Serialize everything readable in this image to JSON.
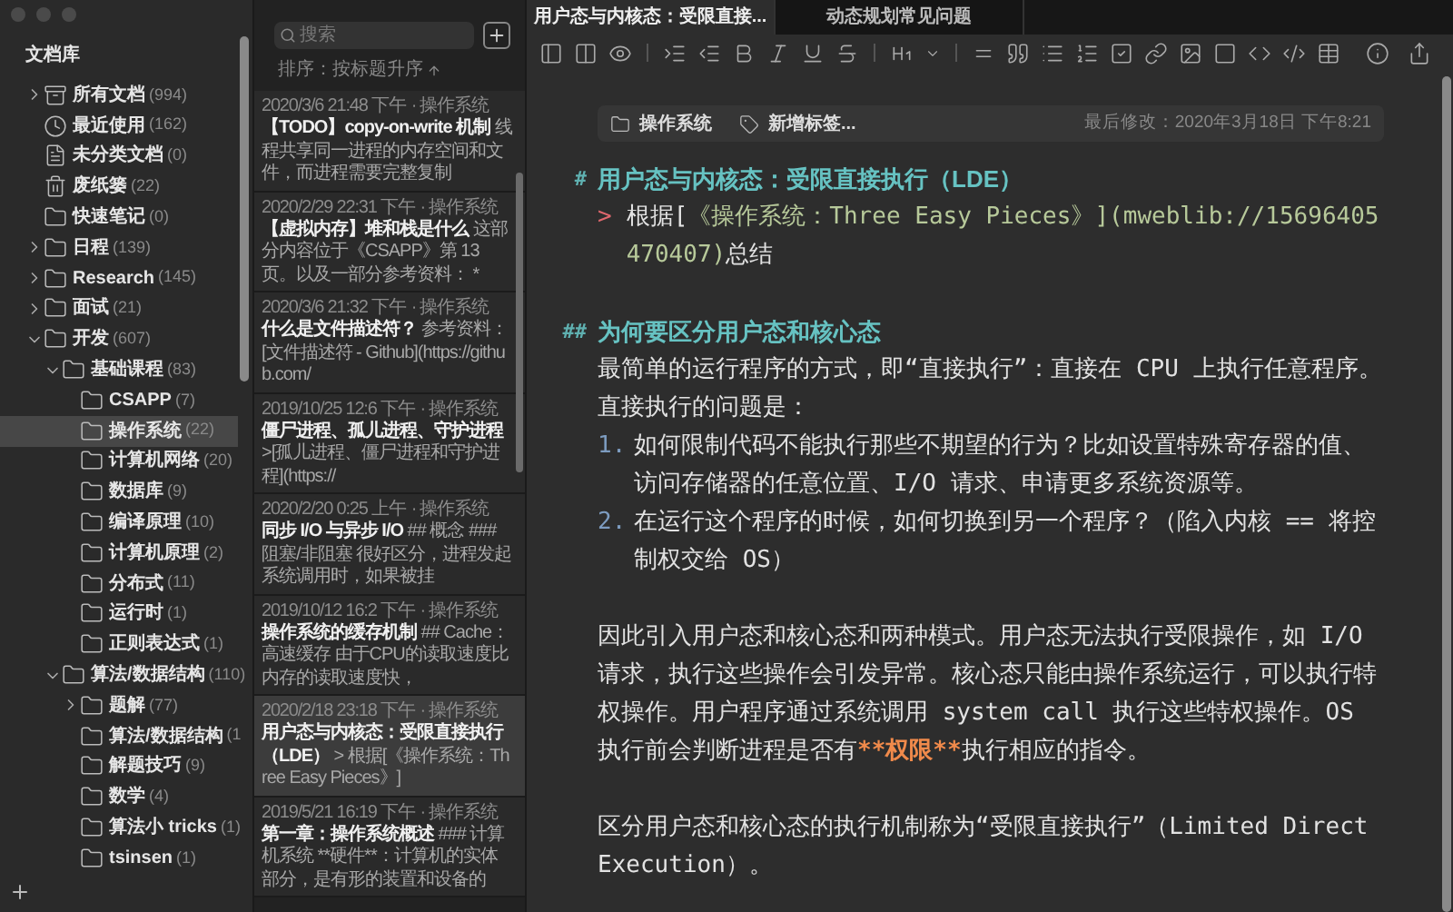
{
  "sidebar": {
    "title": "文档库",
    "items": [
      {
        "label": "所有文档",
        "count": "(994)",
        "kind": "archive",
        "expanded": false,
        "selected": false
      },
      {
        "label": "最近使用",
        "count": "(162)",
        "kind": "clock",
        "selected": false
      },
      {
        "label": "未分类文档",
        "count": "(0)",
        "kind": "document",
        "selected": false
      },
      {
        "label": "废纸篓",
        "count": "(22)",
        "kind": "trash",
        "selected": false
      },
      {
        "label": "快速笔记",
        "count": "(0)",
        "kind": "folder",
        "selected": false
      },
      {
        "label": "日程",
        "count": "(139)",
        "kind": "folder",
        "expanded": false,
        "selected": false
      },
      {
        "label": "Research",
        "count": "(145)",
        "kind": "folder",
        "expanded": false,
        "selected": false
      },
      {
        "label": "面试",
        "count": "(21)",
        "kind": "folder",
        "expanded": false,
        "selected": false
      },
      {
        "label": "开发",
        "count": "(607)",
        "kind": "folder",
        "expanded": true,
        "selected": false,
        "children": [
          {
            "label": "基础课程",
            "count": "(83)",
            "kind": "folder",
            "expanded": true,
            "selected": false,
            "children": [
              {
                "label": "CSAPP",
                "count": "(7)",
                "kind": "folder",
                "selected": false
              },
              {
                "label": "操作系统",
                "count": "(22)",
                "kind": "folder",
                "selected": true
              },
              {
                "label": "计算机网络",
                "count": "(20)",
                "kind": "folder",
                "selected": false
              },
              {
                "label": "数据库",
                "count": "(9)",
                "kind": "folder",
                "selected": false
              },
              {
                "label": "编译原理",
                "count": "(10)",
                "kind": "folder",
                "selected": false
              },
              {
                "label": "计算机原理",
                "count": "(2)",
                "kind": "folder",
                "selected": false
              },
              {
                "label": "分布式",
                "count": "(11)",
                "kind": "folder",
                "selected": false
              },
              {
                "label": "运行时",
                "count": "(1)",
                "kind": "folder",
                "selected": false
              },
              {
                "label": "正则表达式",
                "count": "(1)",
                "kind": "folder",
                "selected": false
              }
            ]
          },
          {
            "label": "算法/数据结构",
            "count": "(110)",
            "kind": "folder",
            "expanded": true,
            "selected": false,
            "children": [
              {
                "label": "题解",
                "count": "(77)",
                "kind": "folder",
                "expanded": false,
                "selected": false
              },
              {
                "label": "算法/数据结构",
                "count": "(1",
                "kind": "folder",
                "selected": false
              },
              {
                "label": "解题技巧",
                "count": "(9)",
                "kind": "folder",
                "selected": false
              },
              {
                "label": "数学",
                "count": "(4)",
                "kind": "folder",
                "selected": false
              },
              {
                "label": "算法小 tricks",
                "count": "(1)",
                "kind": "folder",
                "selected": false
              },
              {
                "label": "tsinsen",
                "count": "(1)",
                "kind": "folder",
                "selected": false
              }
            ]
          }
        ]
      }
    ]
  },
  "note_list": {
    "search": {
      "placeholder": "搜索"
    },
    "sort": "排序：按标题升序",
    "notes": [
      {
        "date": "2020/3/6 21:48 下午",
        "folder": "· 操作系统",
        "title": "【TODO】copy-on-write 机制",
        "excerpt": "线程共享同一进程的内存空间和文件，而进程需要完整复制",
        "selected": false
      },
      {
        "date": "2020/2/29 22:31 下午",
        "folder": "· 操作系统",
        "title": "【虚拟内存】堆和栈是什么",
        "excerpt": "这部分内容位于《CSAPP》第 13 页。以及一部分参考资料： *",
        "selected": false
      },
      {
        "date": "2020/3/6 21:32 下午",
        "folder": "· 操作系统",
        "title": "什么是文件描述符？",
        "excerpt": "参考资料：[文件描述符 - Github](https://github.com/",
        "selected": false
      },
      {
        "date": "2019/10/25 12:6 下午",
        "folder": "· 操作系统",
        "title": "僵尸进程、孤儿进程、守护进程",
        "excerpt": ">[孤儿进程、僵尸进程和守护进程](https://",
        "selected": false
      },
      {
        "date": "2020/2/20 0:25 上午",
        "folder": "· 操作系统",
        "title": "同步 I/O 与异步 I/O",
        "excerpt": "## 概念 ### 阻塞/非阻塞 很好区分，进程发起系统调用时，如果被挂",
        "selected": false
      },
      {
        "date": "2019/10/12 16:2 下午",
        "folder": "· 操作系统",
        "title": "操作系统的缓存机制",
        "excerpt": "## Cache：高速缓存 由于CPU的读取速度比内存的读取速度快，",
        "selected": false
      },
      {
        "date": "2020/2/18 23:18 下午",
        "folder": "· 操作系统",
        "title": "用户态与内核态：受限直接执行（LDE）",
        "excerpt": "> 根据[《操作系统：Three Easy Pieces》]",
        "selected": true
      },
      {
        "date": "2019/5/21 16:19 下午",
        "folder": "· 操作系统",
        "title": "第一章：操作系统概述",
        "excerpt": "### 计算机系统 **硬件**：计算机的实体部分，是有形的装置和设备的",
        "selected": false
      }
    ]
  },
  "tabs": [
    {
      "label": "用户态与内核态：受限直接...",
      "selected": true
    },
    {
      "label": "动态规划常见问题",
      "selected": false
    }
  ],
  "meta": {
    "folder": "操作系统",
    "tag_placeholder": "新增标签...",
    "modified": "最后修改：2020年3月18日 下午8:21"
  },
  "document": [
    {
      "kind": "heading",
      "marker": "#",
      "text": "用户态与内核态：受限直接执行（LDE）"
    },
    {
      "kind": "quote",
      "marker": ">",
      "segments": [
        {
          "kind": "plain",
          "text": "根据["
        },
        {
          "kind": "link",
          "text": "《操作系统：Three Easy Pieces》"
        },
        {
          "kind": "url",
          "text": "](mweblib://15696405470407)"
        },
        {
          "kind": "plain",
          "text": "总结"
        }
      ]
    },
    {
      "kind": "heading",
      "marker": "##",
      "text": "为何要区分用户态和核心态"
    },
    {
      "kind": "paragraph",
      "segments": [
        {
          "kind": "plain",
          "text": "最简单的运行程序的方式，即“直接执行”：直接在 CPU 上执行任意程序。直接执行的问题是："
        }
      ]
    },
    {
      "kind": "list",
      "items": [
        {
          "marker": "1.",
          "text": "如何限制代码不能执行那些不期望的行为？比如设置特殊寄存器的值、访问存储器的任意位置、I/O 请求、申请更多系统资源等。"
        },
        {
          "marker": "2.",
          "text": "在运行这个程序的时候，如何切换到另一个程序？（陷入内核 == 将控制权交给 OS）"
        }
      ]
    },
    {
      "kind": "paragraph",
      "segments": [
        {
          "kind": "plain",
          "text": "因此引入用户态和核心态和两种模式。用户态无法执行受限操作，如 I/O 请求，执行这些操作会引发异常。核心态只能由操作系统运行，可以执行特权操作。用户程序通过系统调用 system call 执行这些特权操作。OS 执行前会判断进程是否有"
        },
        {
          "kind": "strong",
          "text": "**权限**"
        },
        {
          "kind": "plain",
          "text": "执行相应的指令。"
        }
      ]
    },
    {
      "kind": "paragraph",
      "segments": [
        {
          "kind": "plain",
          "text": "区分用户态和核心态的执行机制称为“受限直接执行”（Limited Direct Execution）。"
        }
      ]
    }
  ]
}
